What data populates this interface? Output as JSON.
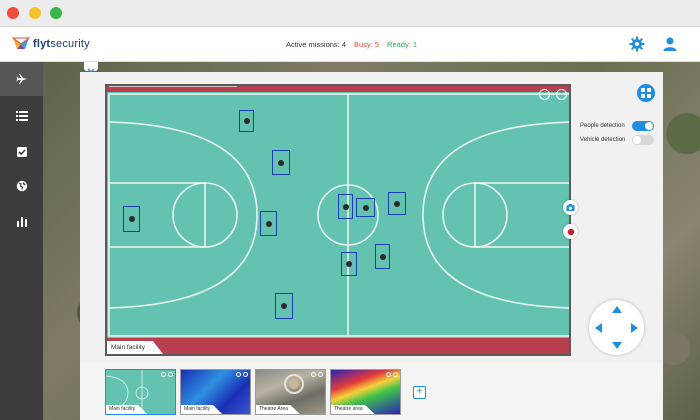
{
  "window": {
    "controls": [
      "close",
      "minimize",
      "maximize"
    ]
  },
  "header": {
    "brand_light": "flyt",
    "brand_rest": "security",
    "active_missions": "Active missions: 4",
    "busy": "Busy: 5",
    "ready": "Ready: 1",
    "icons": [
      "settings-gear-icon",
      "user-icon"
    ]
  },
  "sidebar": {
    "items": [
      {
        "icon": "plane-icon",
        "active": true
      },
      {
        "icon": "list-icon",
        "active": false
      },
      {
        "icon": "checkbox-icon",
        "active": false
      },
      {
        "icon": "globe-icon",
        "active": false
      },
      {
        "icon": "bar-chart-icon",
        "active": false
      }
    ]
  },
  "video": {
    "label": "Main facility",
    "detections_count": 11
  },
  "controls": {
    "people_detection": {
      "label": "People detection",
      "enabled": true
    },
    "vehicle_detection": {
      "label": "Vehicle detection",
      "enabled": false
    }
  },
  "thumbnails": [
    {
      "label": "Main facility",
      "kind": "rgb",
      "selected": true
    },
    {
      "label": "Main facility",
      "kind": "thermal",
      "selected": false
    },
    {
      "label": "Theatre Area",
      "kind": "rgb",
      "selected": false
    },
    {
      "label": "Theatre area",
      "kind": "thermal",
      "selected": false
    }
  ],
  "add_label": "+",
  "colors": {
    "accent": "#1f8de0",
    "busy": "#e0473a",
    "ready": "#3aa655",
    "sidebar": "#3d3d3d",
    "court": "#63c2b0",
    "detection_box": "#1a3fb0"
  }
}
